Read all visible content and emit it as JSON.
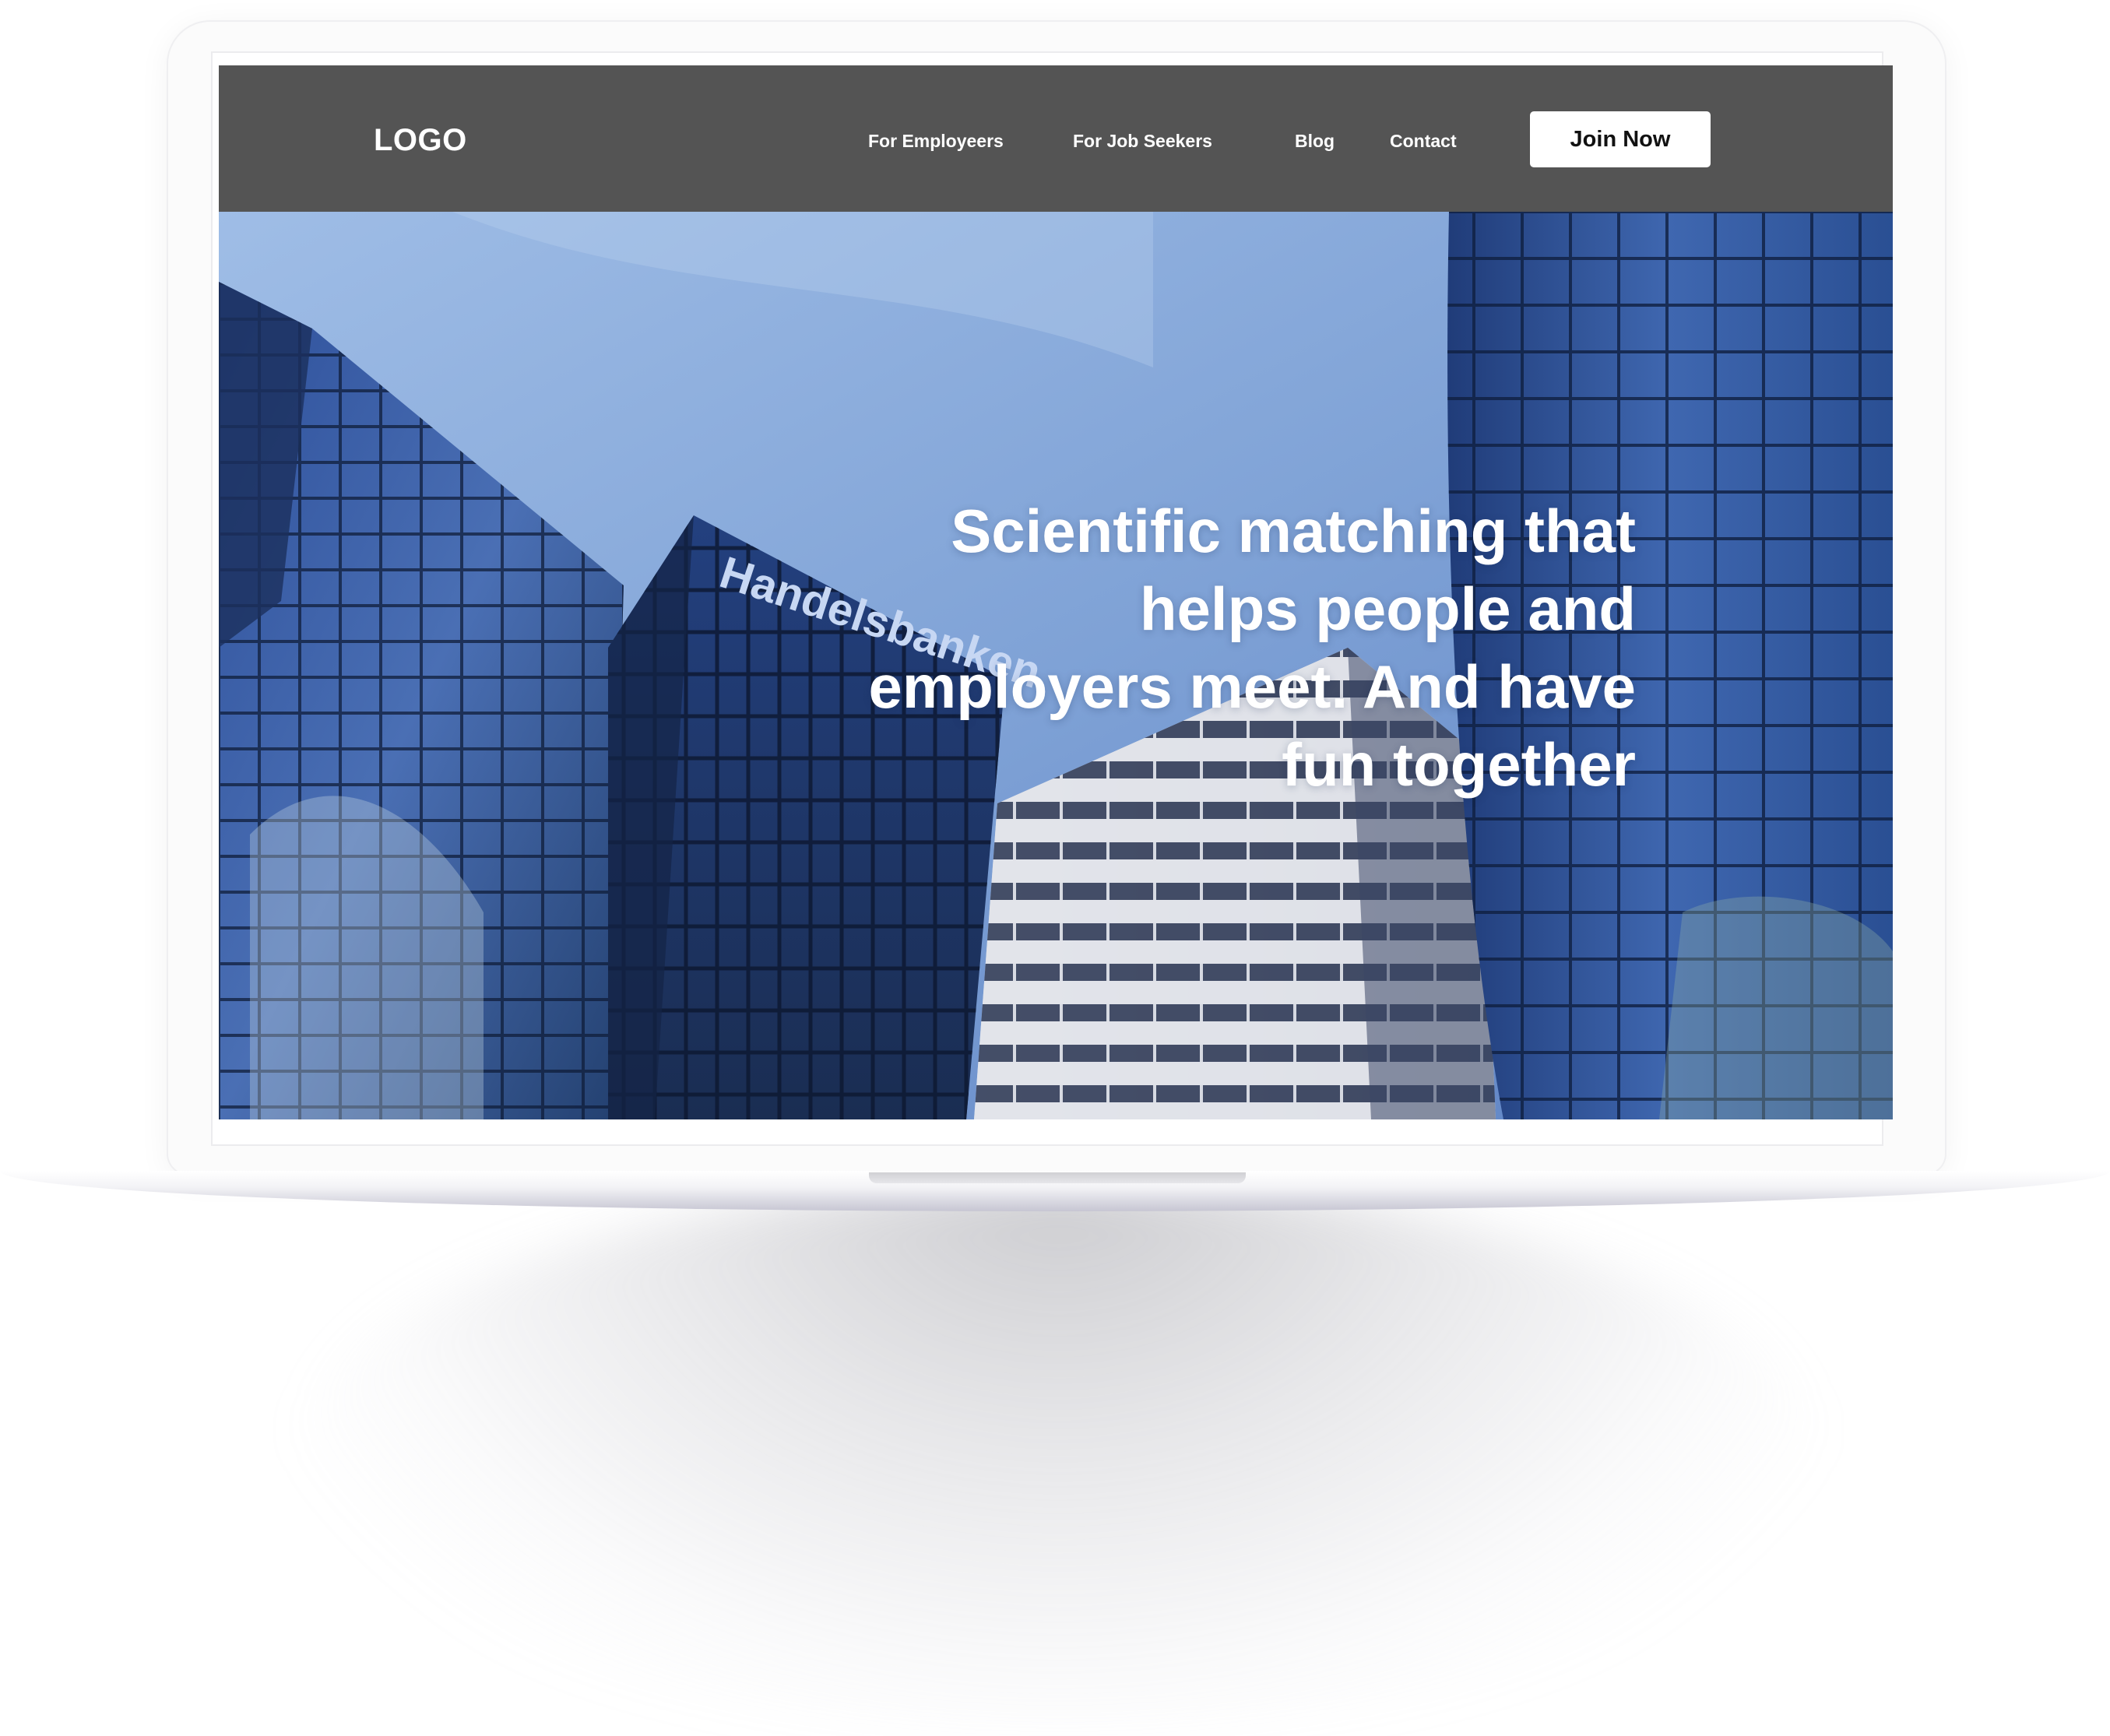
{
  "nav": {
    "logo": "LOGO",
    "links": [
      "For Employeers",
      "For Job Seekers",
      "Blog",
      "Contact"
    ],
    "cta": "Join Now"
  },
  "hero": {
    "headline": "Scientific matching that helps people and employers meet. And have fun together",
    "building_sign": "Handelsbanken"
  },
  "colors": {
    "navbar": "#545454",
    "button_bg": "#ffffff",
    "text_light": "#ffffff",
    "sky": "#7fa2d6"
  }
}
